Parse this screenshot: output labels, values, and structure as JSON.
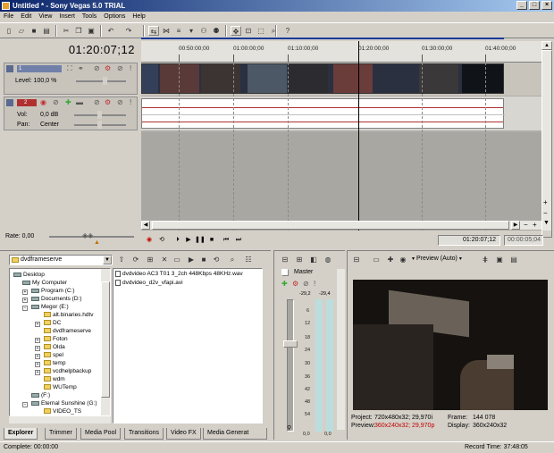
{
  "window": {
    "title": "Untitled * - Sony Vegas 5.0 TRIAL",
    "min_glyph": "_",
    "max_glyph": "□",
    "close_glyph": "×"
  },
  "menu": [
    "File",
    "Edit",
    "View",
    "Insert",
    "Tools",
    "Options",
    "Help"
  ],
  "timeline": {
    "cursor_time": "01:20:07;12",
    "ruler_labels": [
      "00:50:00;00",
      "01:00:00;00",
      "01:10:00;00",
      "01:20:00;00",
      "01:30:00;00",
      "01:40:00;00"
    ],
    "rate": "Rate: 0,00",
    "transport_time": "01:20:07;12",
    "transport_time2": "00:00:05;04"
  },
  "video_track": {
    "number": "1",
    "level": "Level: 100,0 %"
  },
  "audio_track": {
    "number": "2",
    "vol_label": "Vol:",
    "vol_value": "0,0 dB",
    "pan_label": "Pan:",
    "pan_value": "Center"
  },
  "explorer": {
    "path": "dvdframeserve",
    "tree": [
      {
        "label": "Desktop",
        "icon": "desktop-icon"
      },
      {
        "label": "My Computer",
        "icon": "computer-icon"
      },
      {
        "label": "Program (C:)",
        "icon": "drive-icon"
      },
      {
        "label": "Documents (D:)",
        "icon": "drive-icon"
      },
      {
        "label": "Megor (E:)",
        "icon": "drive-icon"
      },
      {
        "label": "alt.binaries.hdtv",
        "icon": "folder-icon"
      },
      {
        "label": "DC",
        "icon": "folder-icon"
      },
      {
        "label": "dvdframeserve",
        "icon": "folder-icon"
      },
      {
        "label": "Foton",
        "icon": "folder-icon"
      },
      {
        "label": "Olda",
        "icon": "folder-icon"
      },
      {
        "label": "spel",
        "icon": "folder-icon"
      },
      {
        "label": "temp",
        "icon": "folder-icon"
      },
      {
        "label": "vcdhelpbackup",
        "icon": "folder-icon"
      },
      {
        "label": "wdm",
        "icon": "folder-icon"
      },
      {
        "label": "WUTemp",
        "icon": "folder-icon"
      },
      {
        "label": "(F:)",
        "icon": "drive-icon"
      },
      {
        "label": "Eternal Sunshine (G:)",
        "icon": "drive-icon"
      },
      {
        "label": "VIDEO_TS",
        "icon": "folder-icon"
      }
    ],
    "files": [
      "dvdvideo AC3 T01 3_2ch 448Kbps 48KHz.wav",
      "dvdvideo_d2v_vfapi.avi"
    ]
  },
  "tabs": [
    "Explorer",
    "Trimmer",
    "Media Pool",
    "Transitions",
    "Video FX",
    "Media Generat"
  ],
  "mixer": {
    "master_label": "Master",
    "peak_left": "-29,2",
    "peak_right": "-29,4",
    "scale": [
      "6",
      "12",
      "18",
      "24",
      "30",
      "36",
      "42",
      "48",
      "54"
    ],
    "fader_left": "0,0",
    "fader_right": "0,0"
  },
  "preview": {
    "mode": "Preview (Auto)",
    "project_label": "Project:",
    "project_value": "720x480x32; 29,970i",
    "preview_label": "Preview:",
    "preview_value": "360x240x32; 29,970p",
    "frame_label": "Frame:",
    "frame_value": "144 078",
    "display_label": "Display:",
    "display_value": "360x240x32"
  },
  "status": {
    "left": "Complete: 00:00:00",
    "right": "Record Time: 37:48:05"
  },
  "colors": {
    "preview_value": "#c00000",
    "title_gradient_start": "#0a246a",
    "title_gradient_end": "#a6caf0",
    "audio_wave": "#b03030"
  }
}
